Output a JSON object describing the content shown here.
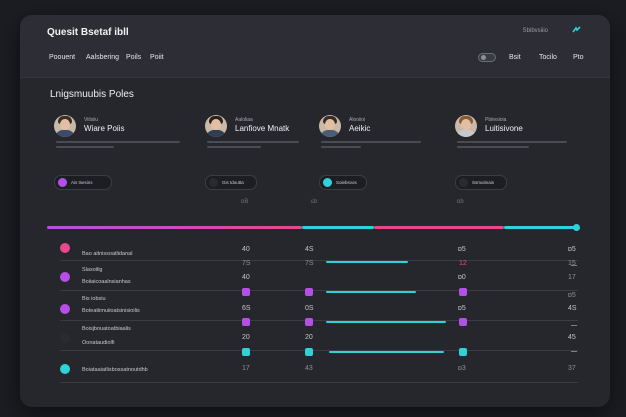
{
  "app": {
    "title": "Quesit Bsetaf ibll",
    "status_text": "Sbibvsiiio",
    "logo_icon": "brand-logo-icon"
  },
  "nav": {
    "items": [
      "Poouent",
      "Aalsbering",
      "Poils",
      "Poiit"
    ],
    "right_items": [
      "Bsit",
      "Tocilo",
      "Pto"
    ]
  },
  "section": {
    "title": "Lnigsmuubis Poles"
  },
  "cards": [
    {
      "role": "Viilsiiu",
      "name": "Wiare Poiis",
      "button": "Ais tsesins",
      "accent": "#b64fe8",
      "hair": "#3c2e24",
      "shirt": "#3b4b6b"
    },
    {
      "role": "Aaloliaa",
      "name": "Lanfiove Mnatk",
      "button": "Gis tdoutta",
      "accent": "#2a2b31",
      "hair": "#2b201a",
      "shirt": "#2f3d55"
    },
    {
      "role": "Alooiioi",
      "name": "Aeikic",
      "button": "Soiebsvos",
      "accent": "#2fd2d9",
      "hair": "#3a2c22",
      "shirt": "#4a5d78"
    },
    {
      "role": "Pbiiesioia",
      "name": "Luitisivone",
      "button": "Ssmutinais",
      "accent": "#2a2b31",
      "hair": "#8a5a34",
      "shirt": "#c7c9cf"
    }
  ],
  "markers": [
    "ɒB",
    "ɛb",
    "ɒb"
  ],
  "rows": [
    {
      "label": "Bao aitnissoatlidanal",
      "color": "#e8488b",
      "values": [
        "40",
        "4S",
        "ɒ5",
        "ɒ5"
      ]
    },
    {
      "label": "Slasoilig",
      "color": "#b64fe8",
      "values": [
        "7S",
        "7S",
        "12",
        "15"
      ]
    },
    {
      "label": "Boiiaicoaalnsianhas",
      "color": "#2a2b31",
      "values": [
        "40",
        "",
        "ɒ0",
        "17"
      ]
    },
    {
      "label": "Bis iobsiu",
      "color": "#b64fe8",
      "values": [
        "",
        "",
        "",
        "ɒ5"
      ]
    },
    {
      "label": "Boteatiimuiioatsinisioilis",
      "color": "#2a2b31",
      "values": [
        "6S",
        "0S",
        "ɒ5",
        "4S"
      ]
    },
    {
      "label": "Boisjbouatoatbiaalis",
      "color": "#2a2b31",
      "values": [
        "",
        "",
        "",
        ""
      ]
    },
    {
      "label": "Oonataudiolfi",
      "color": "#2a2b31",
      "values": [
        "20",
        "20",
        "",
        "45"
      ]
    },
    {
      "label": "Boiataaiatlisbossatnoutdhb",
      "color": "#2fd2d9",
      "values": [
        "17",
        "43",
        "ɒ3",
        "37"
      ]
    }
  ],
  "colors": {
    "pink": "#e8488b",
    "purple": "#b64fe8",
    "cyan": "#2fd2d9"
  }
}
